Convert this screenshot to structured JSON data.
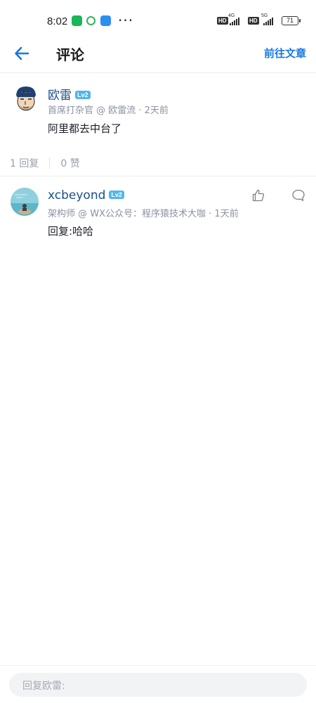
{
  "status_bar": {
    "time": "8:02",
    "more": "···",
    "hd_1": "HD",
    "net_1": "4G",
    "hd_2": "HD",
    "net_2": "5G",
    "battery": "71"
  },
  "header": {
    "title": "评论",
    "action": "前往文章"
  },
  "main_comment": {
    "author": "欧雷",
    "level": "Lv2",
    "meta": "首席打杂官 @ 欧雷流  ·  2天前",
    "text": "阿里都去中台了",
    "stats": {
      "replies": "1 回复",
      "likes": "0 赞"
    }
  },
  "replies": [
    {
      "author": "xcbeyond",
      "level": "Lv2",
      "meta": "架构师 @ WX公众号：程序猿技术大咖  ·  1天前",
      "text": "回复:哈哈"
    }
  ],
  "reply_input": {
    "placeholder": "回复欧雷:"
  },
  "colors": {
    "accent": "#1677e5",
    "name": "#1a4f8c",
    "meta": "#8a919f",
    "level_badge": "#4fb6ec"
  }
}
